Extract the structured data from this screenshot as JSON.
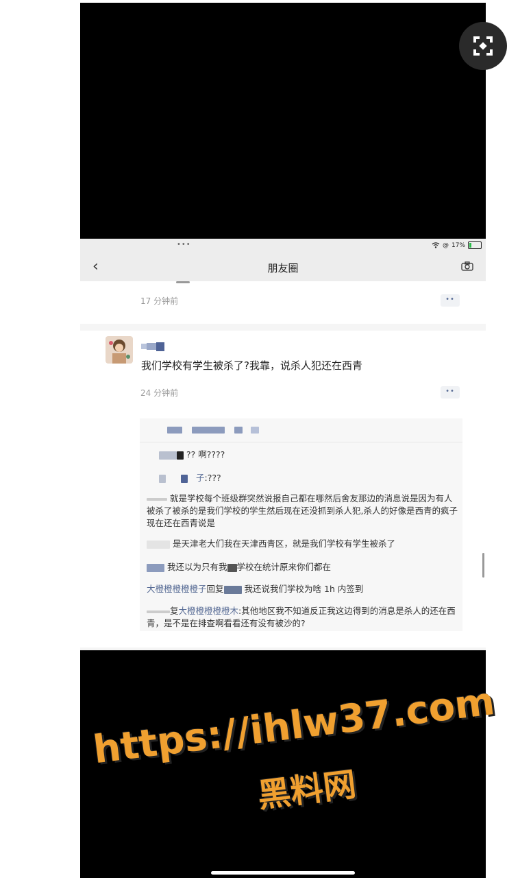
{
  "statusbar": {
    "dots": "•••",
    "battery": "17%"
  },
  "nav": {
    "back": "‹",
    "title": "朋友圈"
  },
  "post1": {
    "time": "17 分钟前",
    "more": "••"
  },
  "post2": {
    "content": "我们学校有学生被杀了?我靠，说杀人犯还在西青",
    "time": "24 分钟前",
    "more": "••"
  },
  "comments": [
    {
      "text": "?? 啊????"
    },
    {
      "name_tail": "子",
      "text": ":???"
    },
    {
      "text": "就是学校每个班级群突然说报自己都在哪然后舍友那边的消息说是因为有人被杀了被杀的是我们学校的学生然后现在还没抓到杀人犯,杀人的好像是西青的疯子现在还在西青说是"
    },
    {
      "text": "是天津老大们我在天津西青区，就是我们学校有学生被杀了"
    },
    {
      "text": "我还以为只有我",
      "text2": "学校在统计原来你们都在"
    },
    {
      "name": "大橙橙橙橙橙子",
      "reply": "回复",
      "text": "我还说我们学校为啥 1h 内签到"
    },
    {
      "reply": "复",
      "name": "大橙橙橙橙橙木",
      "text": ":其他地区我不知道反正我这边得到的消息是杀人的还在西青，是不是在排查啊看看还有没有被沙的?"
    }
  ],
  "watermark": {
    "line1": "https://ihlw37.com",
    "line2": "黑料网"
  },
  "icons": {
    "expand": "expand-icon",
    "camera": "camera-icon",
    "wifi": "wifi-icon"
  }
}
